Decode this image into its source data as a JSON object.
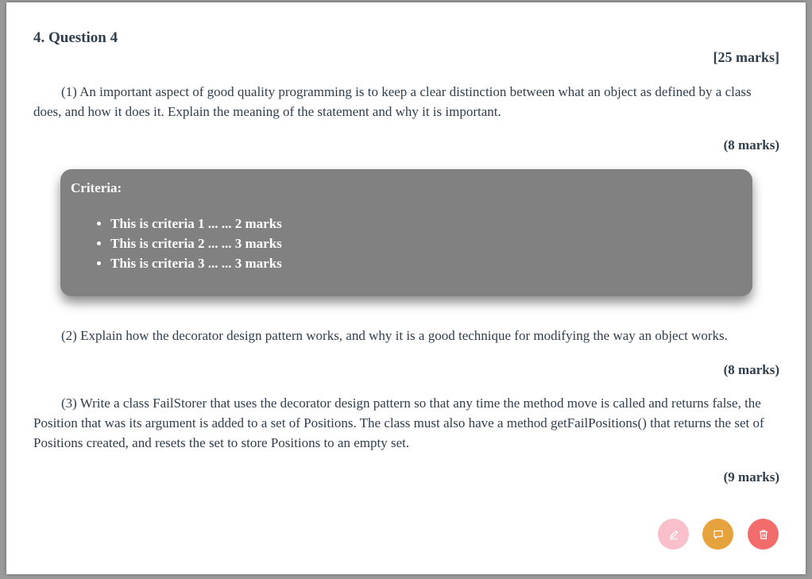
{
  "question": {
    "title": "4. Question 4",
    "total_marks": "[25 marks]"
  },
  "parts": [
    {
      "text": "(1) An important aspect of good quality programming is to keep a clear distinction between what an object as defined by a class does, and how it does it. Explain the meaning of the statement and why it is important.",
      "marks": "(8 marks)"
    },
    {
      "text": "(2) Explain how the decorator design pattern works, and why it is a good technique for modifying the way an object works.",
      "marks": "(8 marks)"
    },
    {
      "text": "(3) Write a class FailStorer that uses the decorator design pattern so that any time the method move is called and returns false, the Position that was its argument is added to a set of Positions. The class must also have a method getFailPositions() that returns the set of Positions created, and resets the set to store Positions to an empty set.",
      "marks": "(9 marks)"
    }
  ],
  "criteria": {
    "heading": "Criteria:",
    "items": [
      "This is criteria 1 ... ... 2 marks",
      "This is criteria 2 ... ... 3 marks",
      "This is criteria 3 ... ... 3 marks"
    ]
  },
  "actions": {
    "edit_icon": "edit-icon",
    "comment_icon": "comment-icon",
    "delete_icon": "trash-icon"
  },
  "colors": {
    "text": "#2f3e4d",
    "criteria_bg": "#818181",
    "edit_btn": "#f9c0cb",
    "comment_btn": "#e6a23c",
    "delete_btn": "#f36c6c"
  }
}
